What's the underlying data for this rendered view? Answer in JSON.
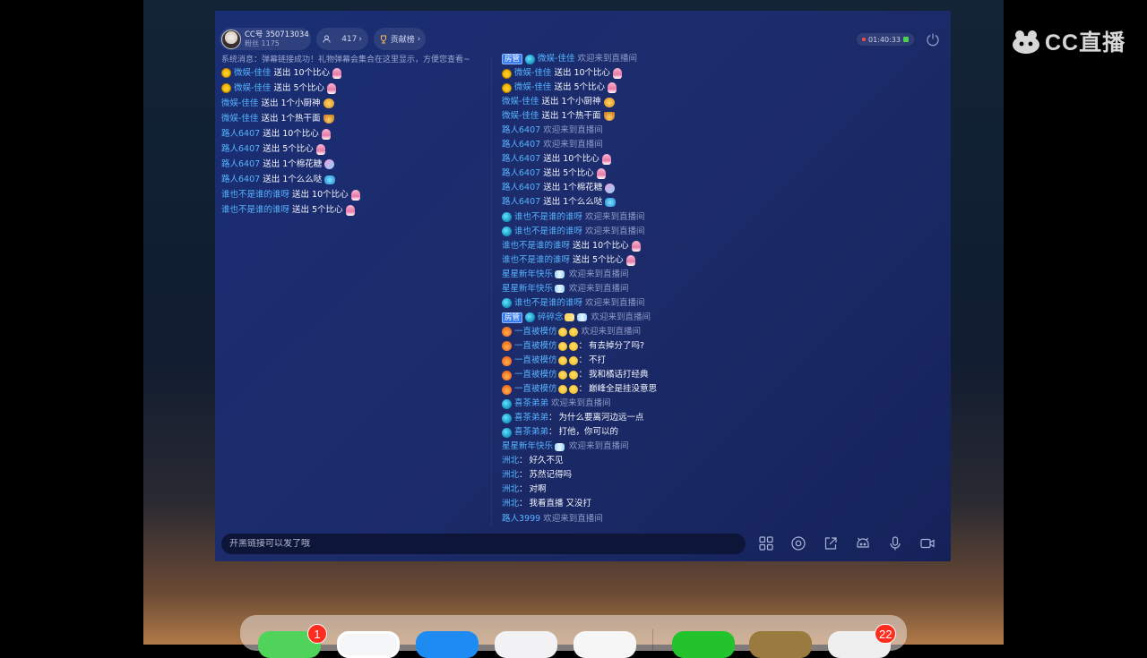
{
  "watermark": {
    "text": "CC直播"
  },
  "header": {
    "anchor_id": "CC号 350713034",
    "anchor_fans": "粉丝 1175",
    "viewers": "417",
    "rank_label": "贡献榜",
    "timer": "01:40:33"
  },
  "left_panel": {
    "system_message": "系统消息：弹幕链接成功！礼物弹幕会集合在这里显示，方便您查看~",
    "rows": [
      {
        "icon": "face",
        "name": "微娱-佳佳",
        "verb": "送出",
        "gift": "10个比心",
        "gift_icon": "heart"
      },
      {
        "icon": "face",
        "name": "微娱-佳佳",
        "verb": "送出",
        "gift": "5个比心",
        "gift_icon": "heart"
      },
      {
        "icon": "",
        "name": "微娱-佳佳",
        "verb": "送出",
        "gift": "1个小厨神",
        "gift_icon": "chef"
      },
      {
        "icon": "",
        "name": "微娱-佳佳",
        "verb": "送出",
        "gift": "1个热干面",
        "gift_icon": "noodle"
      },
      {
        "icon": "",
        "name": "路人6407",
        "verb": "送出",
        "gift": "10个比心",
        "gift_icon": "heart"
      },
      {
        "icon": "",
        "name": "路人6407",
        "verb": "送出",
        "gift": "5个比心",
        "gift_icon": "heart"
      },
      {
        "icon": "",
        "name": "路人6407",
        "verb": "送出",
        "gift": "1个棉花糖",
        "gift_icon": "candy"
      },
      {
        "icon": "",
        "name": "路人6407",
        "verb": "送出",
        "gift": "1个么么哒",
        "gift_icon": "mua"
      },
      {
        "icon": "",
        "name": "谁也不是谁的谁呀",
        "verb": "送出",
        "gift": "10个比心",
        "gift_icon": "heart"
      },
      {
        "icon": "",
        "name": "谁也不是谁的谁呀",
        "verb": "送出",
        "gift": "5个比心",
        "gift_icon": "heart"
      }
    ]
  },
  "right_panel": {
    "rows": [
      {
        "badge": "房管",
        "icon": "globe",
        "name": "微娱-佳佳",
        "type": "welcome",
        "text": "欢迎来到直播间"
      },
      {
        "icon": "face",
        "name": "微娱-佳佳",
        "type": "gift",
        "verb": "送出",
        "text": "10个比心",
        "gift_icon": "heart"
      },
      {
        "icon": "face",
        "name": "微娱-佳佳",
        "type": "gift",
        "verb": "送出",
        "text": "5个比心",
        "gift_icon": "heart"
      },
      {
        "name": "微娱-佳佳",
        "type": "gift",
        "verb": "送出",
        "text": "1个小厨神",
        "gift_icon": "chef"
      },
      {
        "name": "微娱-佳佳",
        "type": "gift",
        "verb": "送出",
        "text": "1个热干面",
        "gift_icon": "noodle"
      },
      {
        "name": "路人6407",
        "type": "welcome",
        "text": "欢迎来到直播间"
      },
      {
        "name": "路人6407",
        "type": "welcome",
        "text": "欢迎来到直播间"
      },
      {
        "name": "路人6407",
        "type": "gift",
        "verb": "送出",
        "text": "10个比心",
        "gift_icon": "heart"
      },
      {
        "name": "路人6407",
        "type": "gift",
        "verb": "送出",
        "text": "5个比心",
        "gift_icon": "heart"
      },
      {
        "name": "路人6407",
        "type": "gift",
        "verb": "送出",
        "text": "1个棉花糖",
        "gift_icon": "candy"
      },
      {
        "name": "路人6407",
        "type": "gift",
        "verb": "送出",
        "text": "1个么么哒",
        "gift_icon": "mua"
      },
      {
        "icon": "globe",
        "name": "谁也不是谁的谁呀",
        "type": "welcome",
        "text": "欢迎来到直播间"
      },
      {
        "icon": "globe",
        "name": "谁也不是谁的谁呀",
        "type": "welcome",
        "text": "欢迎来到直播间"
      },
      {
        "name": "谁也不是谁的谁呀",
        "type": "gift",
        "verb": "送出",
        "text": "10个比心",
        "gift_icon": "heart"
      },
      {
        "name": "谁也不是谁的谁呀",
        "type": "gift",
        "verb": "送出",
        "text": "5个比心",
        "gift_icon": "heart"
      },
      {
        "name": "星星新年快乐",
        "suffix": "bfly",
        "type": "welcome",
        "text": "欢迎来到直播间"
      },
      {
        "name": "星星新年快乐",
        "suffix": "bfly",
        "type": "welcome",
        "text": "欢迎来到直播间"
      },
      {
        "icon": "globe",
        "name": "谁也不是谁的谁呀",
        "type": "welcome",
        "text": "欢迎来到直播间"
      },
      {
        "badge": "房管",
        "icon": "globe",
        "name": "碎碎念",
        "suffix": "bfly2",
        "type": "welcome",
        "text": "欢迎来到直播间"
      },
      {
        "icon": "fire",
        "name": "一直被模仿",
        "suffix": "smile",
        "type": "welcome",
        "text": "欢迎来到直播间"
      },
      {
        "icon": "fire",
        "name": "一直被模仿",
        "suffix": "smile",
        "type": "chat",
        "text": "有去掉分了吗?"
      },
      {
        "icon": "fire",
        "name": "一直被模仿",
        "suffix": "smile",
        "type": "chat",
        "text": "不打"
      },
      {
        "icon": "fire",
        "name": "一直被模仿",
        "suffix": "smile",
        "type": "chat",
        "text": "我和橘话打经典"
      },
      {
        "icon": "fire",
        "name": "一直被模仿",
        "suffix": "smile",
        "type": "chat",
        "text": "巅峰全是挂没意思"
      },
      {
        "icon": "globe",
        "name": "喜茶弟弟",
        "type": "welcome",
        "text": "欢迎来到直播间"
      },
      {
        "icon": "globe",
        "name": "喜茶弟弟",
        "type": "chat",
        "text": "为什么要离河边远一点"
      },
      {
        "icon": "globe",
        "name": "喜茶弟弟",
        "type": "chat",
        "text": "打他，你可以的"
      },
      {
        "name": "星星新年快乐",
        "suffix": "bfly",
        "type": "welcome",
        "text": "欢迎来到直播间"
      },
      {
        "name": "洲北",
        "type": "chat",
        "text": "好久不见"
      },
      {
        "name": "洲北",
        "type": "chat",
        "text": "苏然记得吗"
      },
      {
        "name": "洲北",
        "type": "chat",
        "text": "对啊"
      },
      {
        "name": "洲北",
        "type": "chat",
        "text": "我看直播 又没打"
      },
      {
        "name": "路人3999",
        "type": "welcome",
        "text": "欢迎来到直播间"
      }
    ]
  },
  "input": {
    "placeholder": "开黑链接可以发了哦"
  },
  "toolbar": {
    "icons": [
      "grid-icon",
      "settings-icon",
      "share-icon",
      "emoji-icon",
      "mic-icon",
      "camera-icon"
    ]
  },
  "dock": {
    "badge_left": "1",
    "badge_right": "22"
  },
  "colors": {
    "name_blue": "#56b4ff",
    "panel_bg": "#1c2b6a",
    "badge_red": "#ff2d20"
  }
}
